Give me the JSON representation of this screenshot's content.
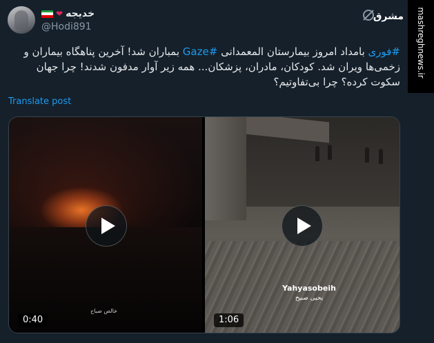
{
  "header": {
    "display_name": "خدیجه",
    "handle": "@Hodi891",
    "flag_colors": [
      "#239f40",
      "#ffffff",
      "#da0000"
    ],
    "apple_icon": "red-apple-emoji",
    "logo_text": "مشرق",
    "watermark_text": "mashreghnews.ir"
  },
  "post": {
    "hashtag_urgent": "#فوری",
    "part1": " بامداد امروز بیمارستان المعمدانی ",
    "hashtag_place": "#Gaze",
    "part2": " بمباران شد! آخرین پناهگاه بیماران و زخمی‌ها ویران شد. کودکان، مادران، پزشکان... همه زیر آوار مدفون شدند! چرا جهان سکوت کرده؟ چرا بی‌تفاوتیم؟",
    "translate_label": "Translate post"
  },
  "media": {
    "video1": {
      "duration": "0:40",
      "caption": "خالص صباح"
    },
    "video2": {
      "duration": "1:06",
      "credit_name": "Yahyasobeih",
      "credit_sub": "يحيى صبيح"
    }
  },
  "colors": {
    "background": "#15202b",
    "accent": "#1d9bf0",
    "text": "#e7e9ea",
    "muted": "#8b98a5"
  }
}
